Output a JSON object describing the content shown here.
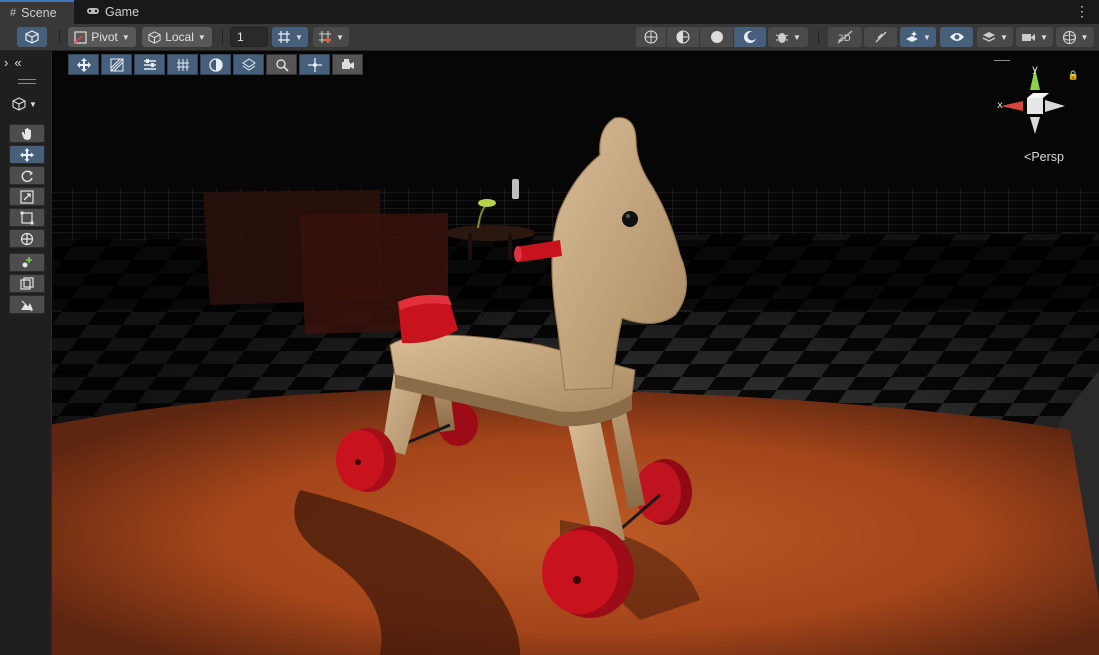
{
  "tabs": [
    {
      "label": "Scene",
      "icon": "#",
      "active": true
    },
    {
      "label": "Game",
      "icon": "◉",
      "active": false
    }
  ],
  "toolbar": {
    "pivot_label": "Pivot",
    "space_label": "Local",
    "snap_value": "1"
  },
  "view": {
    "projection_label": "Persp",
    "axis_x": "x",
    "axis_y": "y"
  },
  "colors": {
    "accent": "#46607c",
    "floor": "#b04e1f",
    "wood": "#c9ab86",
    "red_parts": "#c1121c"
  },
  "icons": {
    "left_tools": [
      "hand-tool-icon",
      "move-tool-icon",
      "rotate-tool-icon",
      "scale-tool-icon",
      "rect-tool-icon",
      "transform-tool-icon",
      "custom-tool-icon",
      "probe-tool-icon",
      "terrain-tool-icon"
    ],
    "overlay": [
      "move-overlay-icon",
      "shading-overlay-icon",
      "align-icon",
      "grid-overlay-icon",
      "lighting-overlay-icon",
      "layers-overlay-icon",
      "search-overlay-icon",
      "navigate-overlay-icon",
      "camera-overlay-icon"
    ]
  }
}
